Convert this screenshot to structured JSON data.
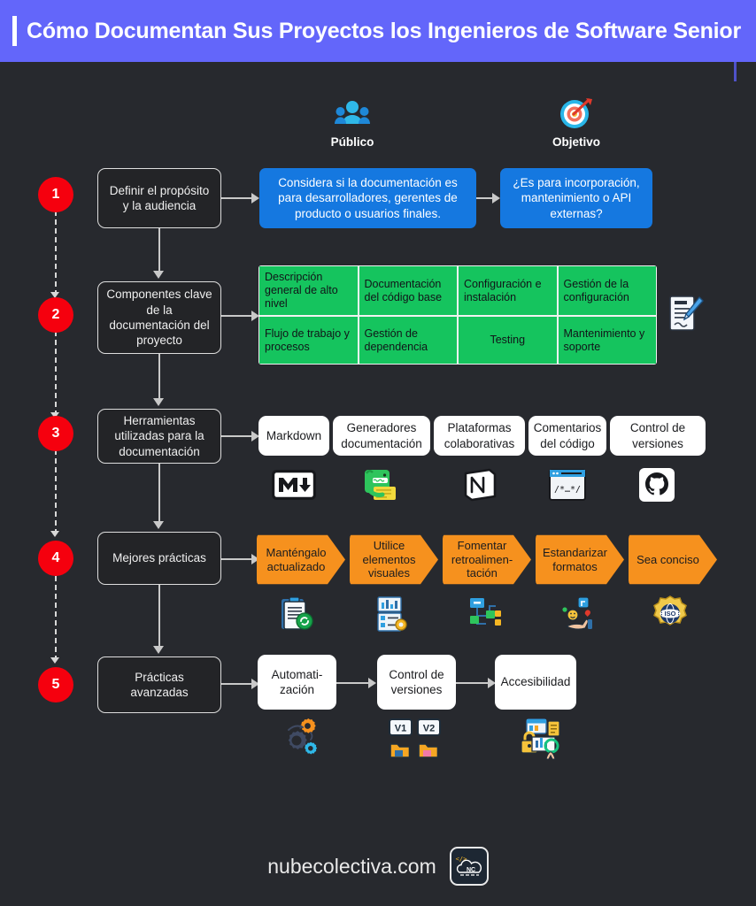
{
  "header": {
    "title": "Cómo Documentan Sus Proyectos los Ingenieros de Software Senior",
    "bg_color": "#6366fa",
    "text_color": "#ffffff"
  },
  "page": {
    "background_color": "#27292e"
  },
  "column_headers": [
    {
      "label": "Público",
      "icon": "people-group-icon"
    },
    {
      "label": "Objetivo",
      "icon": "target-dart-icon"
    }
  ],
  "steps": [
    {
      "number": "1",
      "stage_label": "Definir el propósito y la audiencia"
    },
    {
      "number": "2",
      "stage_label": "Componentes clave de la documentación del proyecto"
    },
    {
      "number": "3",
      "stage_label": "Herramientas utilizadas para la documentación"
    },
    {
      "number": "4",
      "stage_label": "Mejores prácticas"
    },
    {
      "number": "5",
      "stage_label": "Prácticas avanzadas"
    }
  ],
  "row1": {
    "accent_color": "#1578e0",
    "boxes": [
      "Considera si la documentación es para desarrolladores, gerentes de producto o usuarios finales.",
      "¿Es para incorporación, mantenimiento o API externas?"
    ]
  },
  "row2": {
    "accent_color": "#15c45e",
    "side_icon": "document-pen-icon",
    "cells": [
      "Descripción general de alto nivel",
      "Documentación del código base",
      "Configuración e instalación",
      "Gestión de la configuración",
      "Flujo de trabajo y procesos",
      "Gestión de dependencia",
      "Testing",
      "Mantenimiento y soporte"
    ]
  },
  "row3": {
    "items": [
      {
        "label": "Markdown",
        "icon": "markdown-logo-icon"
      },
      {
        "label": "Generadores documentación",
        "icon": "mkdocs-gator-icon"
      },
      {
        "label": "Plataformas colaborativas",
        "icon": "notion-logo-icon"
      },
      {
        "label": "Comentarios del código",
        "icon": "code-comment-window-icon"
      },
      {
        "label": "Control de versiones",
        "icon": "github-logo-icon"
      }
    ]
  },
  "row4": {
    "accent_color": "#f6911e",
    "items": [
      {
        "label": "Manténgalo actualizado",
        "icon": "clipboard-refresh-icon"
      },
      {
        "label": "Utilice elementos visuales",
        "icon": "report-chart-icon"
      },
      {
        "label": "Fomentar retroalimen-tación",
        "icon": "flowchart-nodes-icon"
      },
      {
        "label": "Estandarizar formatos",
        "icon": "hand-feedback-icon"
      },
      {
        "label": "Sea conciso",
        "icon": "iso-badge-icon"
      }
    ]
  },
  "row5": {
    "items": [
      {
        "label": "Automati-zación",
        "icon": "gears-automation-icon"
      },
      {
        "label": "Control de versiones",
        "icon": "version-files-icon",
        "badges": [
          "V1",
          "V2"
        ]
      },
      {
        "label": "Accesibilidad",
        "icon": "accessibility-secure-doc-icon"
      }
    ]
  },
  "footer": {
    "brand": "nubecolectiva.com",
    "logo_text": "NC",
    "logo_code_glyph": "</>"
  }
}
